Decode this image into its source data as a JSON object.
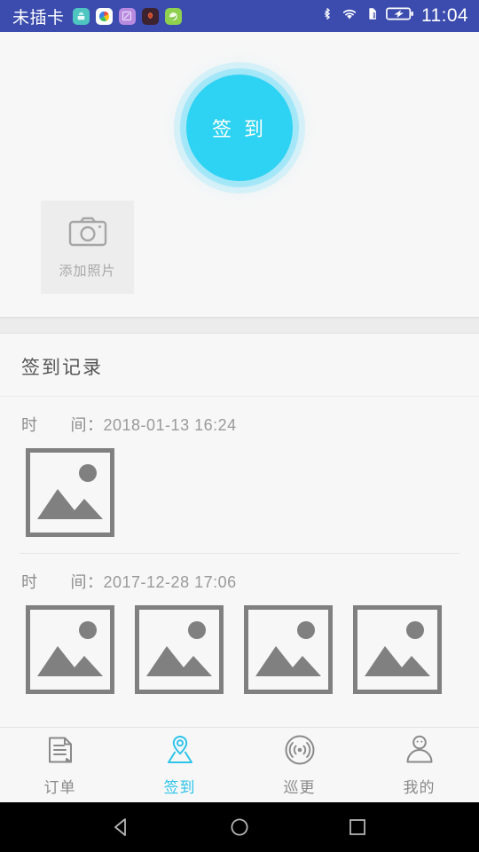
{
  "statusbar": {
    "carrier": "未插卡",
    "time": "11:04",
    "app_icons": [
      "android-app-icon",
      "photos-app-icon",
      "gallery-app-icon",
      "firefox-app-icon",
      "weather-app-icon"
    ],
    "system_icons": [
      "bluetooth-icon",
      "wifi-icon",
      "sim-card-alert-icon",
      "battery-charging-icon"
    ],
    "colors": {
      "background": "#3b4cae",
      "foreground": "#ffffff"
    }
  },
  "signin": {
    "button_label": "签 到",
    "button_color": "#2ed2f2",
    "halo_color": "#8ce4fa"
  },
  "add_photo": {
    "label": "添加照片",
    "icon": "camera-icon"
  },
  "records": {
    "title": "签到记录",
    "time_label": "时　　间：",
    "items": [
      {
        "time": "2018-01-13 16:24",
        "photos": [
          "image-placeholder"
        ]
      },
      {
        "time": "2017-12-28 17:06",
        "photos": [
          "image-placeholder",
          "image-placeholder",
          "image-placeholder",
          "image-placeholder"
        ]
      }
    ]
  },
  "tabbar": {
    "active_color": "#2ec4ea",
    "inactive_color": "#8a8a8a",
    "tabs": [
      {
        "label": "订单",
        "icon": "clipboard-icon",
        "active": false
      },
      {
        "label": "签到",
        "icon": "map-pin-icon",
        "active": true
      },
      {
        "label": "巡更",
        "icon": "signal-waves-icon",
        "active": false
      },
      {
        "label": "我的",
        "icon": "person-icon",
        "active": false
      }
    ]
  },
  "navbar": {
    "buttons": [
      {
        "name": "back-button",
        "icon": "triangle-back-icon"
      },
      {
        "name": "home-button",
        "icon": "circle-home-icon"
      },
      {
        "name": "recents-button",
        "icon": "square-recents-icon"
      }
    ]
  }
}
